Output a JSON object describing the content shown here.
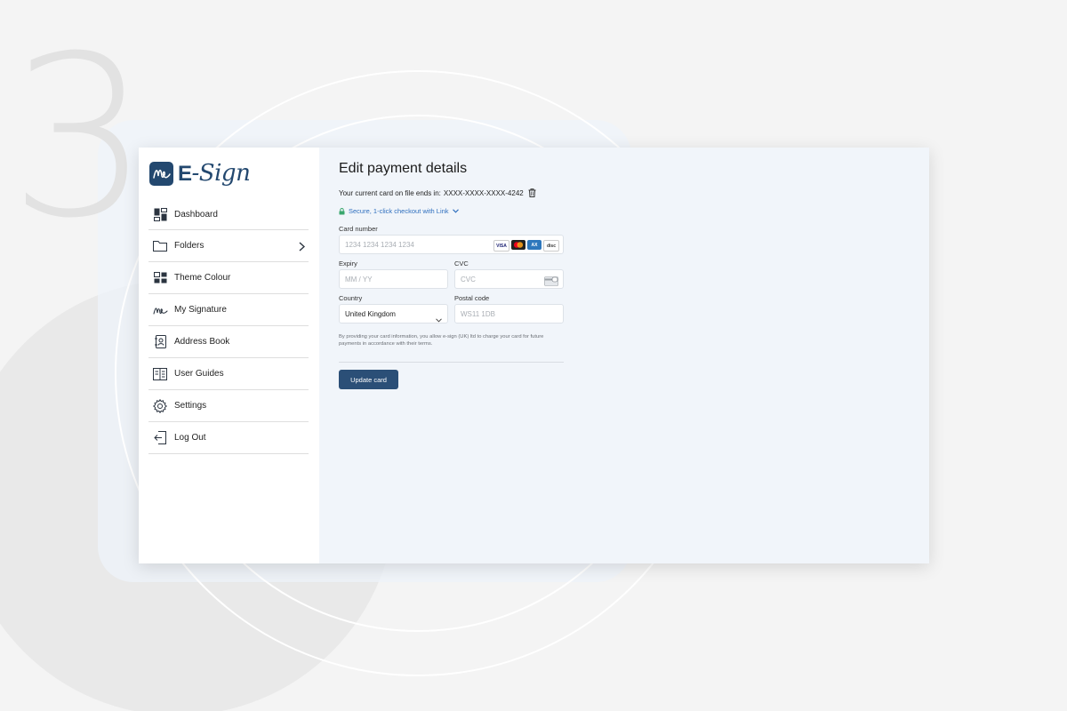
{
  "background": {
    "step_number": "3"
  },
  "brand": {
    "logo_text_e": "E",
    "logo_text_rest": "-Sign",
    "color": "#23486f"
  },
  "sidebar": {
    "items": [
      {
        "label": "Dashboard",
        "icon": "dashboard-icon"
      },
      {
        "label": "Folders",
        "icon": "folder-icon",
        "has_chevron": true
      },
      {
        "label": "Theme Colour",
        "icon": "theme-icon"
      },
      {
        "label": "My Signature",
        "icon": "signature-icon"
      },
      {
        "label": "Address Book",
        "icon": "address-book-icon"
      },
      {
        "label": "User Guides",
        "icon": "user-guides-icon"
      },
      {
        "label": "Settings",
        "icon": "gear-icon"
      },
      {
        "label": "Log Out",
        "icon": "logout-icon"
      }
    ]
  },
  "main": {
    "title": "Edit payment details",
    "current_card_prefix": "Your current card on file ends in:",
    "current_card_mask": "XXXX-XXXX-XXXX-4242",
    "link_checkout_label": "Secure, 1-click checkout with Link",
    "card_number": {
      "label": "Card number",
      "placeholder": "1234 1234 1234 1234",
      "brands": [
        "VISA",
        "mastercard",
        "amex",
        "disc"
      ]
    },
    "expiry": {
      "label": "Expiry",
      "placeholder": "MM / YY"
    },
    "cvc": {
      "label": "CVC",
      "placeholder": "CVC"
    },
    "country": {
      "label": "Country",
      "value": "United Kingdom"
    },
    "postal": {
      "label": "Postal code",
      "placeholder": "WS11 1DB"
    },
    "disclaimer": "By providing your card information, you allow e-sign (UK) ltd to charge your card for future payments in accordance with their terms.",
    "update_button": "Update card"
  },
  "colors": {
    "primary": "#2b4f77",
    "link": "#2f6fbe",
    "chat": "#1c2c4f",
    "main_bg": "#f1f5fa"
  }
}
